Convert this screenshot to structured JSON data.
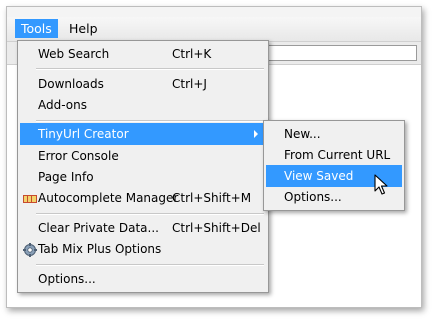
{
  "menubar": {
    "tools_label": "Tools",
    "help_label": "Help"
  },
  "tools_menu": {
    "items": [
      {
        "label": "Web Search",
        "accel": "Ctrl+K"
      },
      {
        "label": "Downloads",
        "accel": "Ctrl+J"
      },
      {
        "label": "Add-ons",
        "accel": ""
      },
      {
        "label": "TinyUrl Creator",
        "accel": ""
      },
      {
        "label": "Error Console",
        "accel": ""
      },
      {
        "label": "Page Info",
        "accel": ""
      },
      {
        "label": "Autocomplete Manager",
        "accel": "Ctrl+Shift+M"
      },
      {
        "label": "Clear Private Data...",
        "accel": "Ctrl+Shift+Del"
      },
      {
        "label": "Tab Mix Plus Options",
        "accel": ""
      },
      {
        "label": "Options...",
        "accel": ""
      }
    ]
  },
  "submenu": {
    "items": [
      {
        "label": "New..."
      },
      {
        "label": "From Current URL"
      },
      {
        "label": "View Saved"
      },
      {
        "label": "Options..."
      }
    ]
  },
  "colors": {
    "highlight": "#3399ff",
    "menu_bg": "#f0f0f0"
  },
  "icons": {
    "autocomplete": "autocomplete-manager-icon",
    "tabmix": "tab-mix-plus-gear-icon",
    "cursor": "mouse-pointer-icon"
  }
}
